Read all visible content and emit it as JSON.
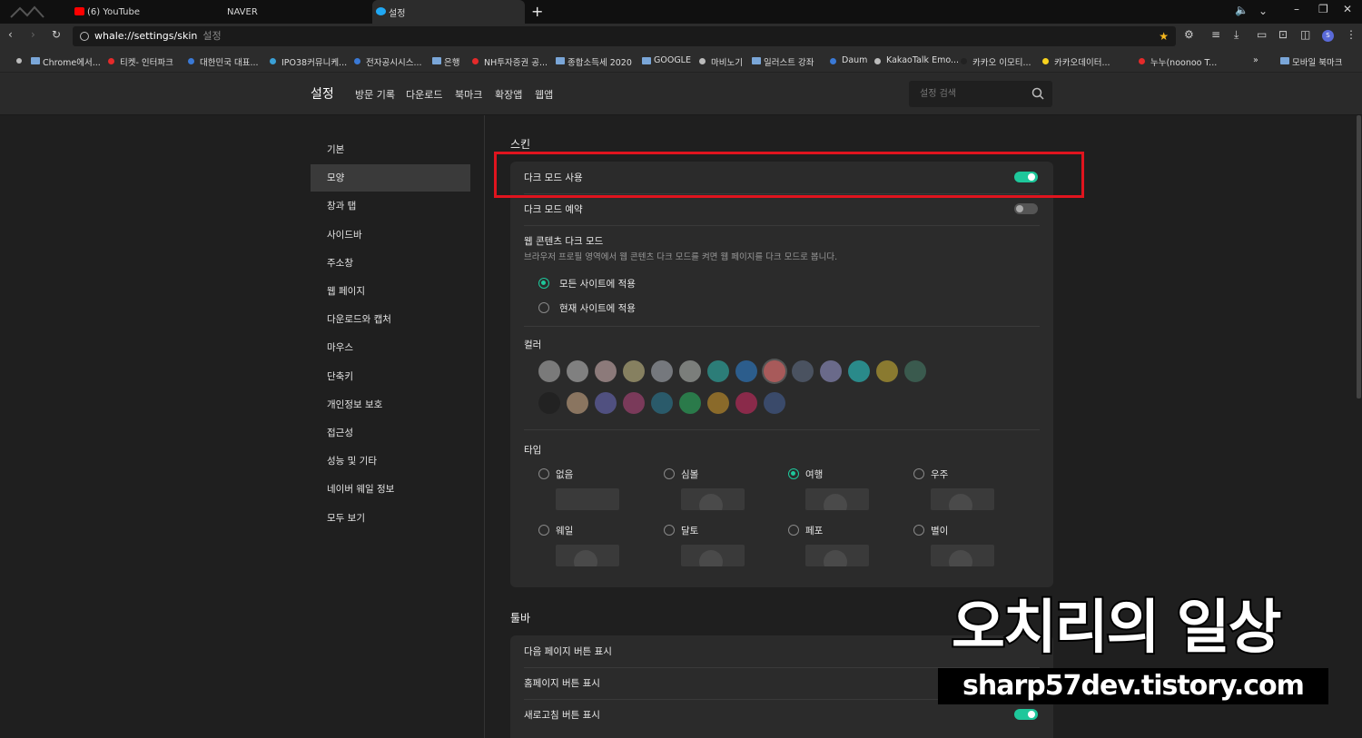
{
  "tabs": [
    {
      "label": "(6) YouTube",
      "favicon_color": "#ff0000"
    },
    {
      "label": "NAVER",
      "favicon_color": ""
    },
    {
      "label": "설정",
      "favicon_color": "#20a8f4"
    }
  ],
  "new_tab": "+",
  "address": {
    "url": "whale://settings/skin",
    "page_name": "설정"
  },
  "bookmarks": [
    {
      "label": "Chrome에서...",
      "kind": "folder",
      "color": "#7aa6d8"
    },
    {
      "label": "티켓- 인터파크",
      "kind": "dot",
      "color": "#e52a2a"
    },
    {
      "label": "대한민국 대표...",
      "kind": "dot",
      "color": "#3a79d6"
    },
    {
      "label": "IPO38커뮤니케...",
      "kind": "dot",
      "color": "#3aa0d6"
    },
    {
      "label": "전자공시시스...",
      "kind": "dot",
      "color": "#3a79d6"
    },
    {
      "label": "은행",
      "kind": "folder",
      "color": "#7aa6d8"
    },
    {
      "label": "NH투자증권 공...",
      "kind": "dot",
      "color": "#e52a2a"
    },
    {
      "label": "종합소득세 2020",
      "kind": "folder",
      "color": "#7aa6d8"
    },
    {
      "label": "GOOGLE",
      "kind": "folder",
      "color": "#7aa6d8"
    },
    {
      "label": "마비노기",
      "kind": "dot",
      "color": "#bbbbbb"
    },
    {
      "label": "일러스트 강좌",
      "kind": "folder",
      "color": "#7aa6d8"
    },
    {
      "label": "Daum",
      "kind": "dot",
      "color": "#3a79d6"
    },
    {
      "label": "KakaoTalk Emo...",
      "kind": "dot",
      "color": "#bbbbbb"
    },
    {
      "label": "카카오 이모티...",
      "kind": "dot",
      "color": "#222222"
    },
    {
      "label": "카카오데이터...",
      "kind": "dot",
      "color": "#f7d21e"
    },
    {
      "label": "누누(noonoo T...",
      "kind": "dot",
      "color": "#e52a2a"
    }
  ],
  "bookmarks_more": "»",
  "mobile_bookmarks": "모바일 북마크",
  "settings_nav": {
    "title": "설정",
    "links": [
      "방문 기록",
      "다운로드",
      "북마크",
      "확장앱",
      "웹앱"
    ],
    "search_placeholder": "설정 검색"
  },
  "sidebar": [
    "기본",
    "모양",
    "창과 탭",
    "사이드바",
    "주소창",
    "웹 페이지",
    "다운로드와 캡처",
    "마우스",
    "단축키",
    "개인정보 보호",
    "접근성",
    "성능 및 기타",
    "네이버 웨일 정보",
    "모두 보기"
  ],
  "sidebar_selected": 1,
  "skin": {
    "title": "스킨",
    "dark_mode": {
      "label": "다크 모드 사용",
      "on": true
    },
    "dark_schedule": {
      "label": "다크 모드 예약",
      "on": false
    },
    "web_dark": {
      "title": "웹 콘텐츠 다크 모드",
      "desc": "브라우저 프로필 영역에서 웹 콘텐츠 다크 모드를 켜면 웹 페이지를 다크 모드로 봅니다.",
      "options": [
        "모든 사이트에 적용",
        "현재 사이트에 적용"
      ],
      "selected": 0
    },
    "color": {
      "title": "컬러",
      "row1": [
        "#7a7a7a",
        "#808080",
        "#8c7a7a",
        "#868060",
        "#75787d",
        "#7b7e7b",
        "#2c7d78",
        "#2c5d8c",
        "#a85a5a",
        "#4a5260",
        "#6a6a8a",
        "#2a8a8a",
        "#8a7a30",
        "#3a5a4e"
      ],
      "row2": [
        "#222222",
        "#8a7560",
        "#505080",
        "#7a3a5a",
        "#2a5a6a",
        "#2a7a4a",
        "#8a6a2a",
        "#8a2a4a",
        "#3a4a6a"
      ]
    },
    "type": {
      "title": "타입",
      "options": [
        "없음",
        "심볼",
        "여행",
        "우주",
        "웨일",
        "달토",
        "페포",
        "별이"
      ],
      "selected": 2
    }
  },
  "toolbar": {
    "title": "툴바",
    "rows": [
      {
        "label": "다음 페이지 버튼 표시"
      },
      {
        "label": "홈페이지 버튼 표시"
      },
      {
        "label": "새로고침 버튼 표시",
        "on": true
      }
    ]
  },
  "watermark": {
    "title": "오치리의 일상",
    "url": "sharp57dev.tistory.com"
  },
  "colors": {
    "accent": "#1ec79b",
    "highlight": "#e0141e"
  }
}
